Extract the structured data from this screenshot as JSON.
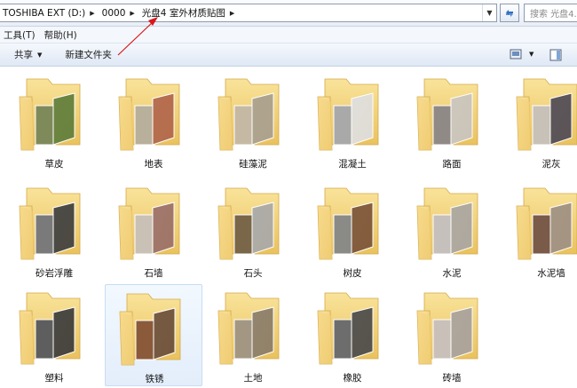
{
  "address": {
    "segments": [
      "TOSHIBA EXT (D:)",
      "0000",
      "光盘4 室外材质贴图"
    ],
    "search_placeholder": "搜索 光盘4..."
  },
  "menu": {
    "items": [
      "工具(T)",
      "帮助(H)"
    ]
  },
  "toolbar": {
    "share_label": "共享",
    "new_folder_label": "新建文件夹"
  },
  "folders": [
    {
      "label": "草皮",
      "textures": [
        "#7f8a5a",
        "#5f7d3a"
      ]
    },
    {
      "label": "地表",
      "textures": [
        "#b8b09a",
        "#b0654a"
      ]
    },
    {
      "label": "硅藻泥",
      "textures": [
        "#c6b9a4",
        "#a89f8e"
      ]
    },
    {
      "label": "混凝土",
      "textures": [
        "#a9a9a9",
        "#dedede"
      ]
    },
    {
      "label": "路面",
      "textures": [
        "#8f8a86",
        "#c9c4bf"
      ]
    },
    {
      "label": "泥灰",
      "textures": [
        "#c8c1b7",
        "#4f4a55"
      ]
    },
    {
      "label": "砂岩浮雕",
      "textures": [
        "#7a7a7a",
        "#3e3e3e"
      ]
    },
    {
      "label": "石墙",
      "textures": [
        "#c9c1b6",
        "#9a6f68"
      ]
    },
    {
      "label": "石头",
      "textures": [
        "#7a6648",
        "#a8a8a8"
      ]
    },
    {
      "label": "树皮",
      "textures": [
        "#8a8a86",
        "#7a5338"
      ]
    },
    {
      "label": "水泥",
      "textures": [
        "#c5c0bb",
        "#a9a5a1"
      ]
    },
    {
      "label": "水泥墙",
      "textures": [
        "#7a5a49",
        "#9e8f82"
      ]
    },
    {
      "label": "塑料",
      "textures": [
        "#5e5e5e",
        "#3b3b3b"
      ]
    },
    {
      "label": "铁锈",
      "textures": [
        "#8b5a3a",
        "#6a4e3a"
      ]
    },
    {
      "label": "土地",
      "textures": [
        "#a39783",
        "#8a7c69"
      ]
    },
    {
      "label": "橡胶",
      "textures": [
        "#6d6d6d",
        "#4a4a4a"
      ]
    },
    {
      "label": "砖墙",
      "textures": [
        "#c9c1b9",
        "#a8a19c"
      ]
    }
  ],
  "selected_index": 13
}
